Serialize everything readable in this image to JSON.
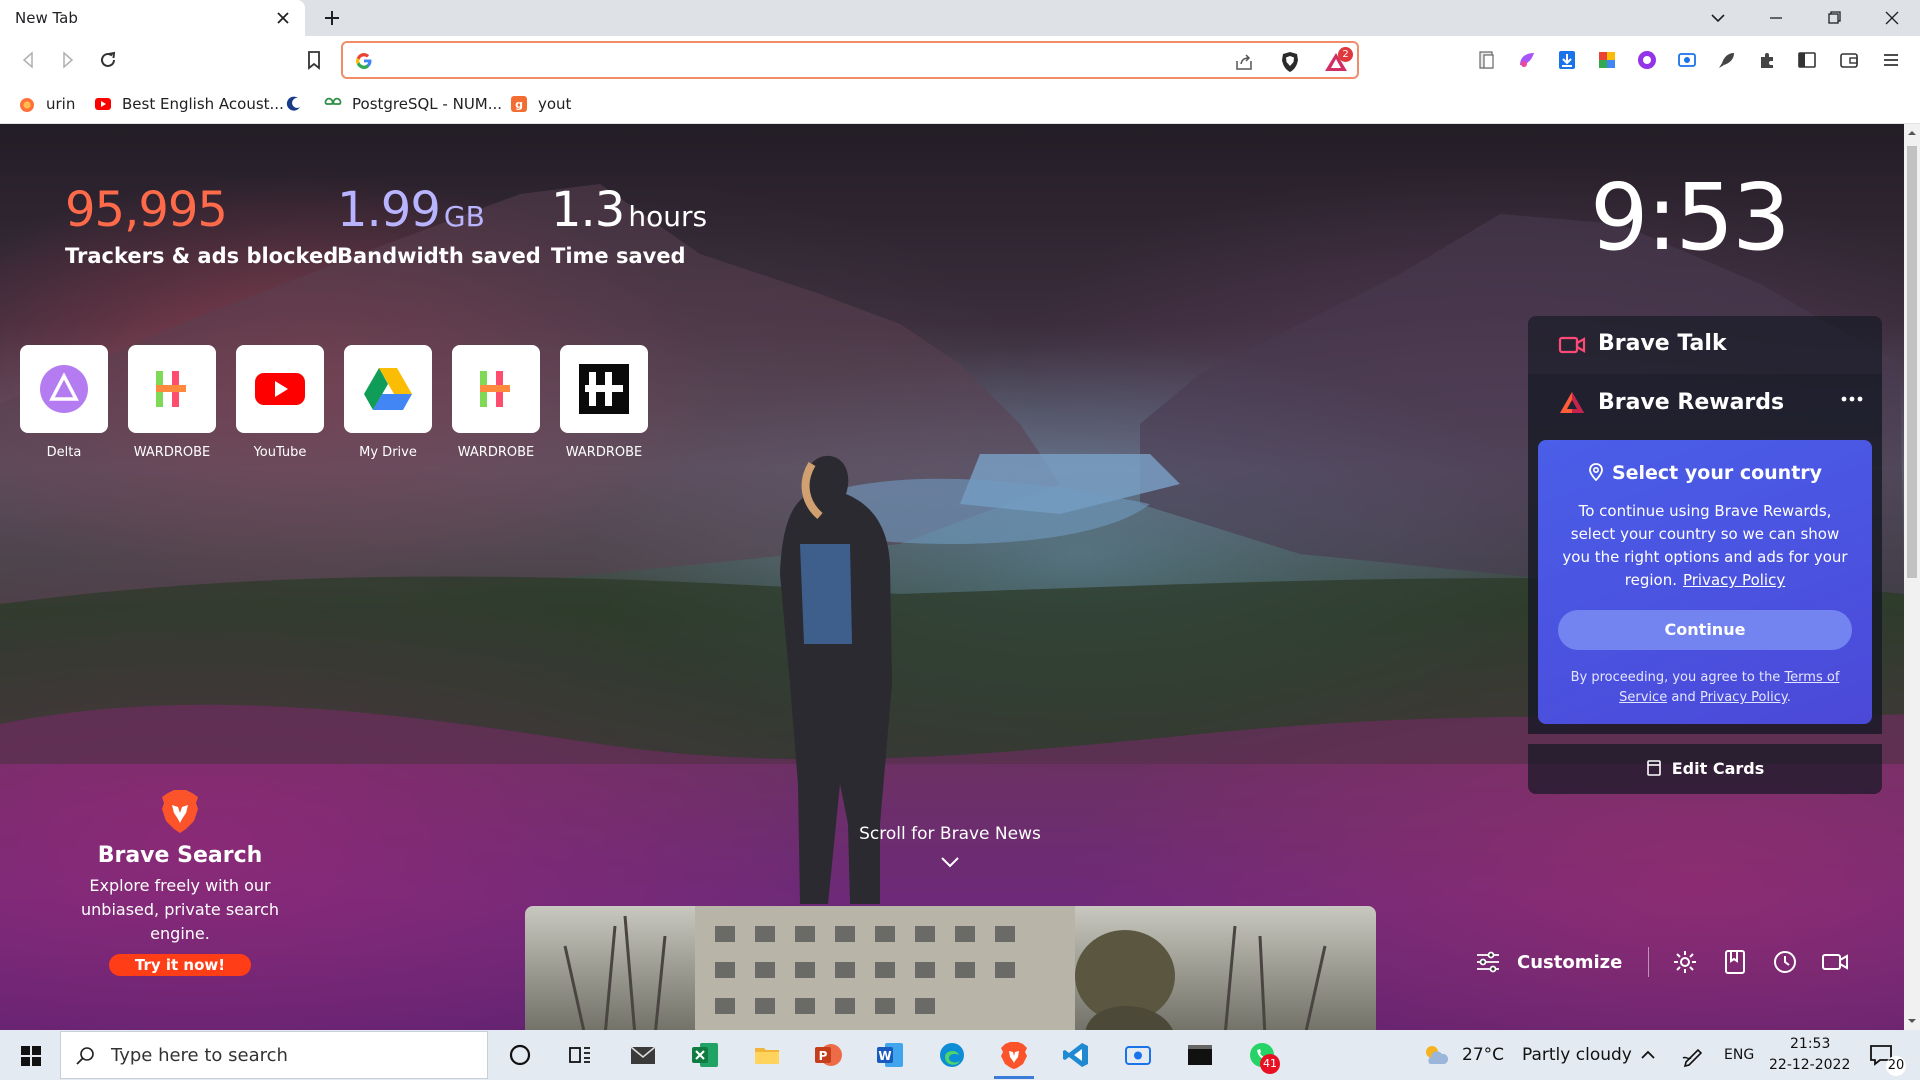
{
  "browser": {
    "tab_title": "New Tab",
    "omnibox_value": "",
    "rewards_badge": "2",
    "bookmarks": [
      {
        "label": "urin"
      },
      {
        "label": "Best English Acoust..."
      },
      {
        "label": ""
      },
      {
        "label": "PostgreSQL - NUM..."
      },
      {
        "label": "yout"
      }
    ]
  },
  "stats": {
    "trackers": {
      "value": "95,995",
      "unit": "",
      "label": "Trackers & ads blocked",
      "color": "#ff6b4a"
    },
    "bandwidth": {
      "value": "1.99",
      "unit": "GB",
      "label": "Bandwidth saved",
      "color": "#b9b4ff"
    },
    "time": {
      "value": "1.3",
      "unit": "hours",
      "label": "Time saved",
      "color": "#ffffff"
    }
  },
  "clock": "9:53",
  "top_sites": [
    {
      "label": "Delta"
    },
    {
      "label": "WARDROBE"
    },
    {
      "label": "YouTube"
    },
    {
      "label": "My Drive"
    },
    {
      "label": "WARDROBE"
    },
    {
      "label": "WARDROBE"
    }
  ],
  "widgets": {
    "talk_title": "Brave Talk",
    "rewards_title": "Brave Rewards",
    "country_title": "Select your country",
    "country_text": "To continue using Brave Rewards, select your country so we can show you the right options and ads for your region.",
    "privacy_link": "Privacy Policy",
    "continue_label": "Continue",
    "terms_prefix": "By proceeding, you agree to the",
    "terms_link": "Terms of Service",
    "terms_and": "and",
    "terms_privacy": "Privacy Policy",
    "terms_end": ".",
    "edit_cards": "Edit Cards"
  },
  "brave_search": {
    "title": "Brave Search",
    "description": "Explore freely with our unbiased, private search engine.",
    "cta": "Try it now!"
  },
  "scroll_news": "Scroll for Brave News",
  "bottom_bar": {
    "customize": "Customize"
  },
  "taskbar": {
    "search_placeholder": "Type here to search",
    "temperature": "27°C",
    "weather": "Partly cloudy",
    "language": "ENG",
    "time": "21:53",
    "date": "22-12-2022",
    "whatsapp_badge": "41",
    "notifications": "20"
  },
  "colors": {
    "accent": "#4b55e0",
    "brave_orange": "#fb542b"
  }
}
